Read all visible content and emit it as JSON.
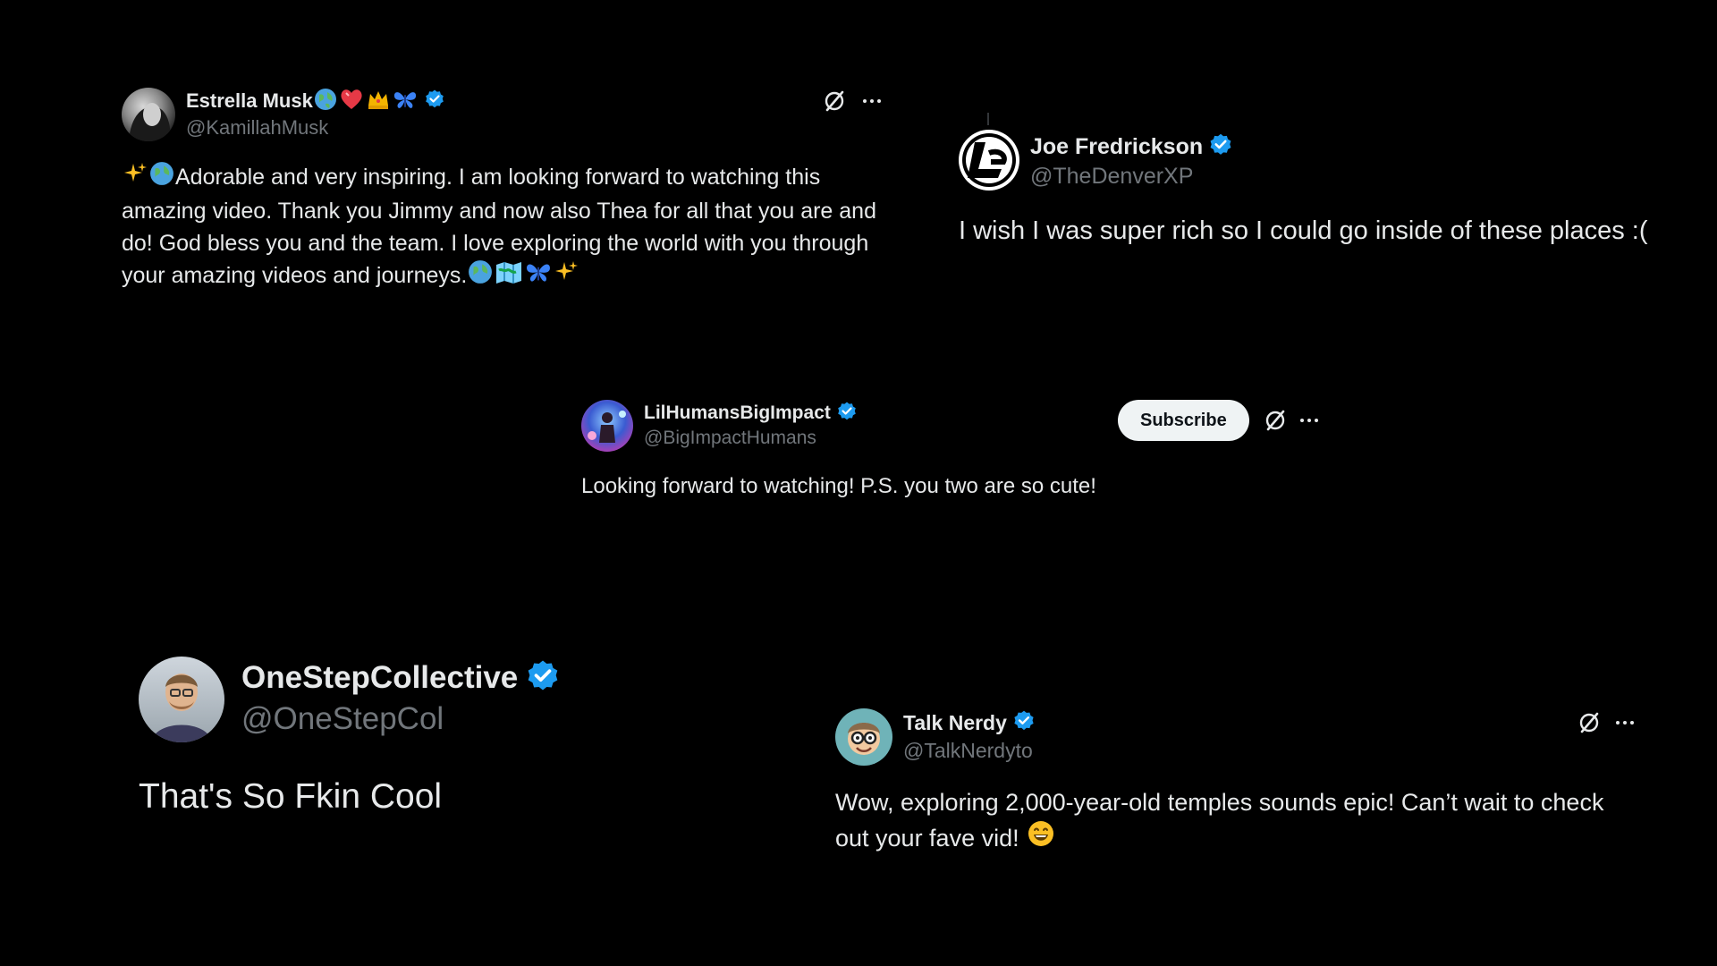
{
  "colors": {
    "background": "#000000",
    "text": "#e7e9ea",
    "muted": "#71767b",
    "verified": "#1d9bf0",
    "button": "#eff3f4"
  },
  "posts": {
    "estrella": {
      "name": "Estrella Musk",
      "name_emojis": [
        "globe-icon",
        "heart-icon",
        "crown-icon",
        "butterfly-icon"
      ],
      "handle": "@KamillahMusk",
      "text": "Adorable and very inspiring. I am looking forward to watching this amazing video. Thank you Jimmy and now also Thea for all that you are and do! God bless you and the team. I love exploring the world with you through your amazing videos and journeys.",
      "lead_emojis": [
        "sparkles-icon",
        "globe-icon"
      ],
      "trail_emojis": [
        "globe-icon",
        "map-icon",
        "butterfly-icon",
        "sparkles-icon"
      ]
    },
    "joe": {
      "name": "Joe Fredrickson",
      "handle": "@TheDenverXP",
      "text": "I wish I was super rich so I could go inside of these places :("
    },
    "lilhumans": {
      "name": "LilHumansBigImpact",
      "handle": "@BigImpactHumans",
      "text": "Looking forward to watching! P.S. you two are so cute!",
      "subscribe_label": "Subscribe"
    },
    "onestep": {
      "name": "OneStepCollective",
      "handle": "@OneStepCol",
      "text": "That's So Fkin Cool"
    },
    "talknerdy": {
      "name": "Talk Nerdy",
      "handle": "@TalkNerdyto",
      "text": "Wow, exploring 2,000-year-old temples sounds epic! Can’t wait to check out your fave vid!",
      "trail_emojis": [
        "grinning-face-icon"
      ]
    }
  }
}
